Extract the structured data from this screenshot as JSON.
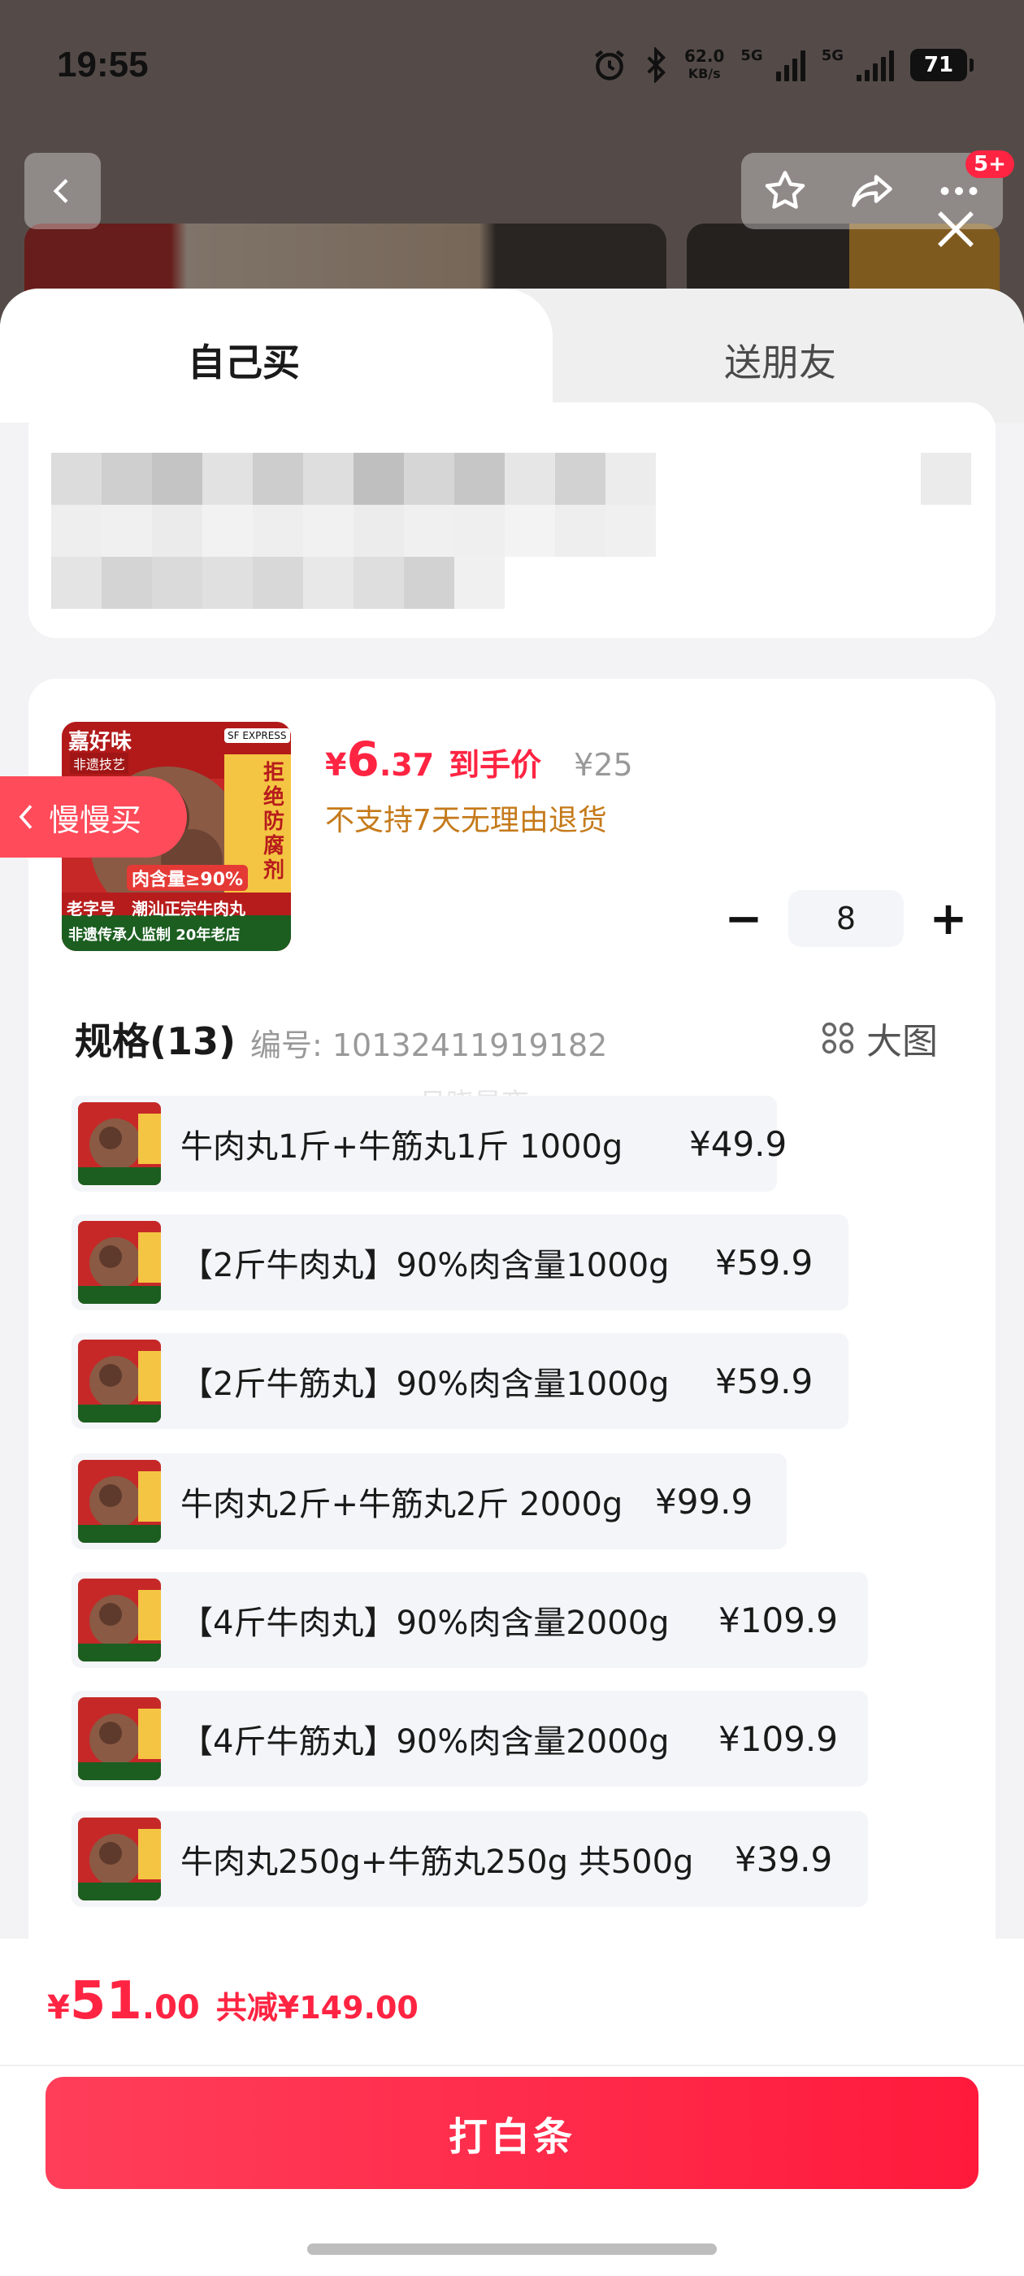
{
  "status_bar": {
    "time": "19:55",
    "net_speed_value": "62.0",
    "net_speed_unit": "KB/s",
    "sim1": "5G",
    "sim2": "5G",
    "battery": "71"
  },
  "top_bar": {
    "notification_badge": "5+"
  },
  "tabs": {
    "self_buy": "自己买",
    "gift_friend": "送朋友"
  },
  "product": {
    "price_symbol": "¥",
    "price_int": "6",
    "price_dec": ".37",
    "price_tag": "到手价",
    "original_price": "¥25",
    "return_policy": "不支持7天无理由退货",
    "image_texts": {
      "brand": "嘉好味",
      "badge1": "非遗技艺",
      "badge2": "SF EXPRESS",
      "side": "拒绝防腐剂",
      "meat": "肉含量≥90%",
      "line1_a": "老字号",
      "line1_b": "潮汕正宗牛肉丸",
      "line2": "非遗传承人监制 20年老店"
    }
  },
  "slow_buy": {
    "label": "慢慢买"
  },
  "quantity": {
    "value": "8",
    "minus": "−",
    "plus": "+"
  },
  "spec": {
    "title": "规格(13)",
    "code": "编号: 10132411919182",
    "big_image": "大图",
    "watermark": "月晓星夜",
    "options": [
      {
        "label": "牛肉丸1斤+牛筋丸1斤 1000g",
        "price": "¥49.9"
      },
      {
        "label": "【2斤牛肉丸】90%肉含量1000g",
        "price": "¥59.9"
      },
      {
        "label": "【2斤牛筋丸】90%肉含量1000g",
        "price": "¥59.9"
      },
      {
        "label": "牛肉丸2斤+牛筋丸2斤 2000g",
        "price": "¥99.9"
      },
      {
        "label": "【4斤牛肉丸】90%肉含量2000g",
        "price": "¥109.9"
      },
      {
        "label": "【4斤牛筋丸】90%肉含量2000g",
        "price": "¥109.9"
      },
      {
        "label": "牛肉丸250g+牛筋丸250g 共500g",
        "price": "¥39.9"
      }
    ]
  },
  "footer": {
    "total_symbol": "¥",
    "total_int": "51",
    "total_dec": ".00",
    "saving": "共减¥149.00",
    "pay_button": "打白条"
  },
  "colors": {
    "accent": "#ff2442",
    "warning": "#c57a1a",
    "option_bg": "#f4f5f8"
  }
}
